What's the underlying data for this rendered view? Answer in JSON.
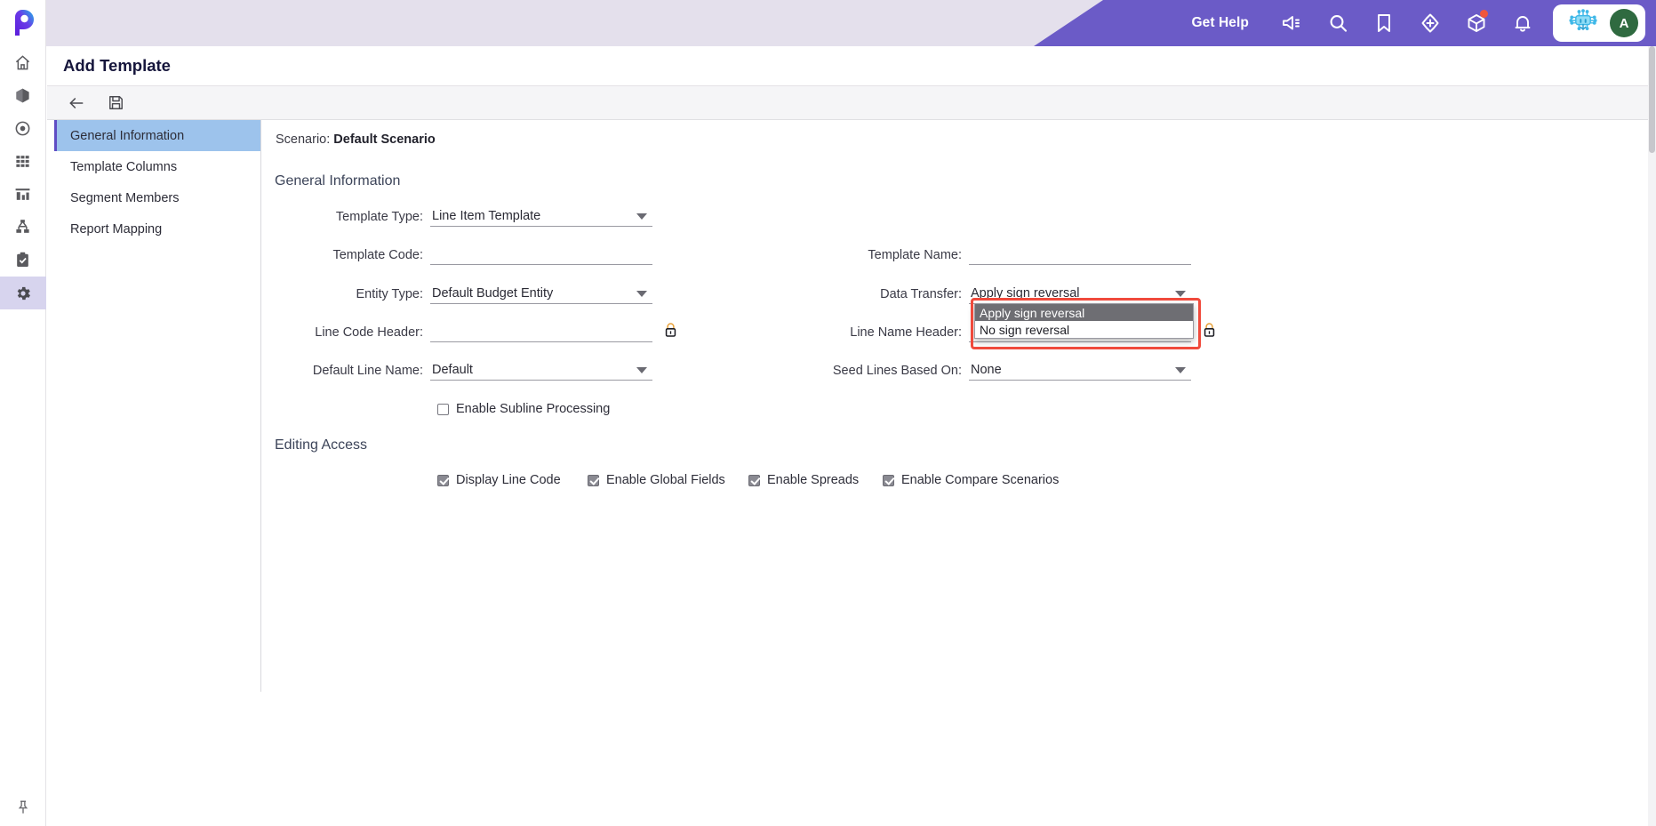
{
  "topbar": {
    "get_help_label": "Get Help",
    "icons": [
      {
        "name": "announcement-icon",
        "glyph": "megaphone"
      },
      {
        "name": "search-icon",
        "glyph": "magnifier"
      },
      {
        "name": "bookmark-icon",
        "glyph": "bookmark"
      },
      {
        "name": "add-shortcut-icon",
        "glyph": "diamond-plus"
      },
      {
        "name": "package-icon",
        "glyph": "cube",
        "badge": true
      },
      {
        "name": "notifications-icon",
        "glyph": "bell"
      }
    ],
    "assistant_icon_name": "ai-chip-icon",
    "avatar_initial": "A",
    "purple": "#6b5bc7",
    "band": "#e4e0ec"
  },
  "rail": {
    "logo_name": "app-logo-p",
    "items": [
      {
        "name": "sidebar-item-home",
        "icon": "home-icon",
        "active": false
      },
      {
        "name": "sidebar-item-models",
        "icon": "cube-icon",
        "active": false
      },
      {
        "name": "sidebar-item-target",
        "icon": "target-icon",
        "active": false
      },
      {
        "name": "sidebar-item-grid",
        "icon": "grid-icon",
        "active": false
      },
      {
        "name": "sidebar-item-reports",
        "icon": "bar-chart-icon",
        "active": false
      },
      {
        "name": "sidebar-item-workflow",
        "icon": "hierarchy-icon",
        "active": false
      },
      {
        "name": "sidebar-item-tasks",
        "icon": "clipboard-check-icon",
        "active": false
      },
      {
        "name": "sidebar-item-settings",
        "icon": "gear-icon",
        "active": true
      }
    ],
    "pin_icon": "pin-icon"
  },
  "page": {
    "title": "Add Template"
  },
  "toolbar": {
    "back_label": "back-arrow",
    "save_label": "save-floppy"
  },
  "nav": {
    "items": [
      {
        "label": "General Information",
        "active": true
      },
      {
        "label": "Template Columns",
        "active": false
      },
      {
        "label": "Segment Members",
        "active": false
      },
      {
        "label": "Report Mapping",
        "active": false
      }
    ]
  },
  "form": {
    "scenario_prefix": "Scenario:",
    "scenario_value": "Default Scenario",
    "section_general": "General Information",
    "section_editing": "Editing Access",
    "left_fields": [
      {
        "label": "Template Type:",
        "value": "Line Item Template",
        "type": "select",
        "lock": false
      },
      {
        "label": "Template Code:",
        "value": "",
        "type": "text",
        "lock": false
      },
      {
        "label": "Entity Type:",
        "value": "Default Budget Entity",
        "type": "select",
        "lock": false
      },
      {
        "label": "Line Code Header:",
        "value": "",
        "type": "text",
        "lock": true
      },
      {
        "label": "Default Line Name:",
        "value": "Default",
        "type": "select",
        "lock": false
      }
    ],
    "right_fields": [
      {
        "label": "Template Name:",
        "value": "",
        "type": "text",
        "lock": false
      },
      {
        "label": "Data Transfer:",
        "value": "Apply sign reversal",
        "type": "select",
        "lock": false
      },
      {
        "label": "Line Name Header:",
        "value": "",
        "type": "text",
        "lock": true
      },
      {
        "label": "Seed Lines Based On:",
        "value": "None",
        "type": "select",
        "lock": false
      }
    ],
    "subline_checkbox": {
      "label": "Enable Subline Processing",
      "checked": false
    },
    "editing_access": [
      {
        "label": "Display Line Code",
        "checked": true
      },
      {
        "label": "Enable Global Fields",
        "checked": true
      },
      {
        "label": "Enable Spreads",
        "checked": true
      },
      {
        "label": "Enable Compare Scenarios",
        "checked": true
      }
    ]
  },
  "dropdown": {
    "open_for": "Data Transfer:",
    "options": [
      {
        "label": "Apply sign reversal",
        "selected": true
      },
      {
        "label": "No sign reversal",
        "selected": false
      }
    ],
    "highlight_color": "#f04a3c"
  }
}
